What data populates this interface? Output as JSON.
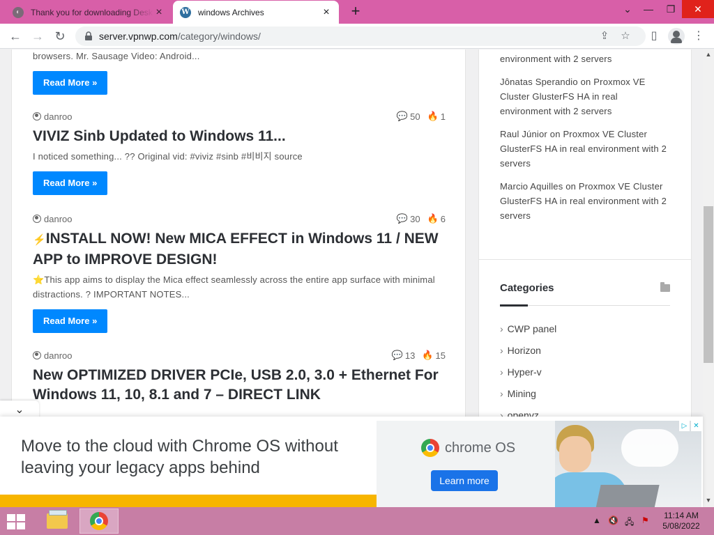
{
  "browser": {
    "tabs": [
      {
        "title": "Thank you for downloading Desktop",
        "active": false
      },
      {
        "title": "windows Archives",
        "active": true
      }
    ],
    "url_host": "server.vpnwp.com",
    "url_path": "/category/windows/"
  },
  "posts": [
    {
      "excerpt_tail": "browsers. Mr. Sausage Video: Android...",
      "read_more": "Read More »"
    },
    {
      "author": "danroo",
      "comments": "50",
      "views": "1",
      "title": "VIVIZ Sinb Updated to Windows 11...",
      "excerpt": "I noticed something... ?? Original vid: #viviz #sinb #비비지 source",
      "read_more": "Read More »"
    },
    {
      "author": "danroo",
      "comments": "30",
      "views": "6",
      "title_prefix": "⚡",
      "title": "INSTALL NOW! New MICA EFFECT in Windows 11 / NEW APP to IMPROVE DESIGN!",
      "excerpt": "⭐This app aims to display the Mica effect seamlessly across the entire app surface with minimal distractions. ? IMPORTANT NOTES...",
      "read_more": "Read More »"
    },
    {
      "author": "danroo",
      "comments": "13",
      "views": "15",
      "title": "New OPTIMIZED DRIVER PCIe, USB 2.0, 3.0 + Ethernet For Windows 11, 10, 8.1 and 7 – DIRECT LINK"
    }
  ],
  "recent_comments": [
    {
      "text": "environment with 2 servers"
    },
    {
      "text": "Jônatas Sperandio on Proxmox VE Cluster GlusterFS HA in real environment with 2 servers"
    },
    {
      "text": "Raul Júnior on Proxmox VE Cluster GlusterFS HA in real environment with 2 servers"
    },
    {
      "text": "Marcio Aquilles on Proxmox VE Cluster GlusterFS HA in real environment with 2 servers"
    }
  ],
  "categories": {
    "heading": "Categories",
    "items": [
      "CWP panel",
      "Horizon",
      "Hyper-v",
      "Mining",
      "openvz"
    ]
  },
  "ad": {
    "headline": "Move to the cloud with Chrome OS without leaving your legacy apps behind",
    "brand": "chrome OS",
    "cta": "Learn more",
    "colors": {
      "accent": "#1a73e8",
      "stripe": "#f7b500"
    }
  },
  "taskbar": {
    "time": "11:14 AM",
    "date": "5/08/2022"
  },
  "colors": {
    "tabstrip": "#d85fa8",
    "button": "#0088ff",
    "taskbar": "#c77ea5"
  }
}
